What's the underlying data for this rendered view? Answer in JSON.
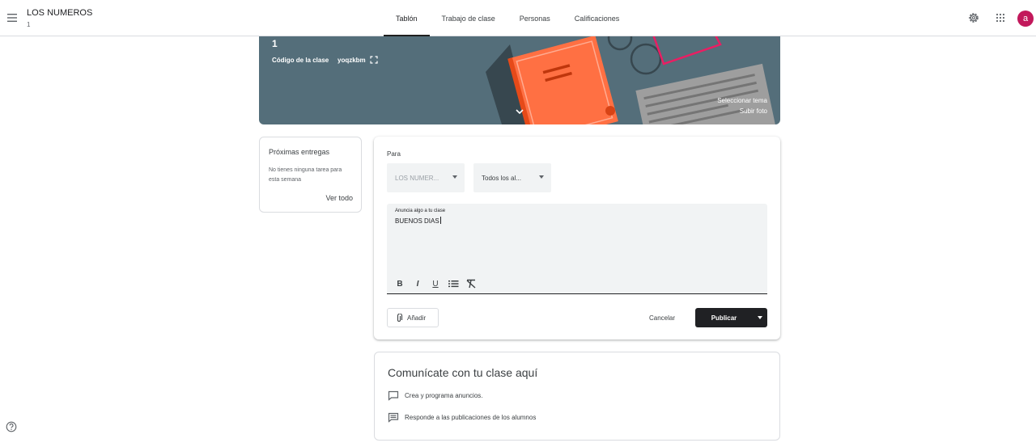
{
  "header": {
    "class_name": "LOS NUMEROS",
    "class_section": "1",
    "tabs": [
      {
        "label": "Tablón",
        "active": true
      },
      {
        "label": "Trabajo de clase",
        "active": false
      },
      {
        "label": "Personas",
        "active": false
      },
      {
        "label": "Calificaciones",
        "active": false
      }
    ],
    "avatar_initial": "a",
    "icons": {
      "menu": "menu-icon",
      "settings": "gear-icon",
      "apps": "apps-grid-icon"
    }
  },
  "banner": {
    "class_number": "1",
    "code_label": "Código de la clase",
    "code": "yoqzkbm",
    "select_theme": "Seleccionar tema",
    "upload_photo": "Subir foto",
    "color": "#546e7a"
  },
  "upcoming": {
    "title": "Próximas entregas",
    "empty_text": "No tienes ninguna tarea para esta semana",
    "view_all": "Ver todo"
  },
  "composer": {
    "for_label": "Para",
    "class_select": "LOS NUMER...",
    "students_select": "Todos los al...",
    "editor_label": "Anuncia algo a tu clase",
    "editor_text": "BUENOS DIAS",
    "format_buttons": [
      "B",
      "I",
      "U"
    ],
    "add_label": "Añadir",
    "cancel_label": "Cancelar",
    "publish_label": "Publicar",
    "accent_color": "#202124"
  },
  "communicate": {
    "title": "Comunícate con tu clase aquí",
    "item1": "Crea y programa anuncios.",
    "item2": "Responde a las publicaciones de los alumnos"
  }
}
